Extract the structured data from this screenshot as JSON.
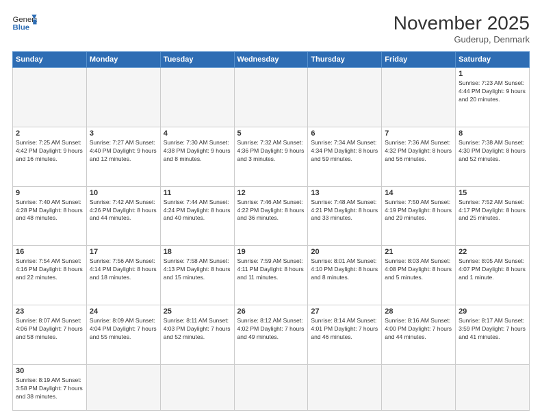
{
  "header": {
    "logo_general": "General",
    "logo_blue": "Blue",
    "month_year": "November 2025",
    "location": "Guderup, Denmark"
  },
  "weekdays": [
    "Sunday",
    "Monday",
    "Tuesday",
    "Wednesday",
    "Thursday",
    "Friday",
    "Saturday"
  ],
  "weeks": [
    [
      {
        "day": "",
        "info": "",
        "empty": true
      },
      {
        "day": "",
        "info": "",
        "empty": true
      },
      {
        "day": "",
        "info": "",
        "empty": true
      },
      {
        "day": "",
        "info": "",
        "empty": true
      },
      {
        "day": "",
        "info": "",
        "empty": true
      },
      {
        "day": "",
        "info": "",
        "empty": true
      },
      {
        "day": "1",
        "info": "Sunrise: 7:23 AM\nSunset: 4:44 PM\nDaylight: 9 hours\nand 20 minutes."
      }
    ],
    [
      {
        "day": "2",
        "info": "Sunrise: 7:25 AM\nSunset: 4:42 PM\nDaylight: 9 hours\nand 16 minutes."
      },
      {
        "day": "3",
        "info": "Sunrise: 7:27 AM\nSunset: 4:40 PM\nDaylight: 9 hours\nand 12 minutes."
      },
      {
        "day": "4",
        "info": "Sunrise: 7:30 AM\nSunset: 4:38 PM\nDaylight: 9 hours\nand 8 minutes."
      },
      {
        "day": "5",
        "info": "Sunrise: 7:32 AM\nSunset: 4:36 PM\nDaylight: 9 hours\nand 3 minutes."
      },
      {
        "day": "6",
        "info": "Sunrise: 7:34 AM\nSunset: 4:34 PM\nDaylight: 8 hours\nand 59 minutes."
      },
      {
        "day": "7",
        "info": "Sunrise: 7:36 AM\nSunset: 4:32 PM\nDaylight: 8 hours\nand 56 minutes."
      },
      {
        "day": "8",
        "info": "Sunrise: 7:38 AM\nSunset: 4:30 PM\nDaylight: 8 hours\nand 52 minutes."
      }
    ],
    [
      {
        "day": "9",
        "info": "Sunrise: 7:40 AM\nSunset: 4:28 PM\nDaylight: 8 hours\nand 48 minutes."
      },
      {
        "day": "10",
        "info": "Sunrise: 7:42 AM\nSunset: 4:26 PM\nDaylight: 8 hours\nand 44 minutes."
      },
      {
        "day": "11",
        "info": "Sunrise: 7:44 AM\nSunset: 4:24 PM\nDaylight: 8 hours\nand 40 minutes."
      },
      {
        "day": "12",
        "info": "Sunrise: 7:46 AM\nSunset: 4:22 PM\nDaylight: 8 hours\nand 36 minutes."
      },
      {
        "day": "13",
        "info": "Sunrise: 7:48 AM\nSunset: 4:21 PM\nDaylight: 8 hours\nand 33 minutes."
      },
      {
        "day": "14",
        "info": "Sunrise: 7:50 AM\nSunset: 4:19 PM\nDaylight: 8 hours\nand 29 minutes."
      },
      {
        "day": "15",
        "info": "Sunrise: 7:52 AM\nSunset: 4:17 PM\nDaylight: 8 hours\nand 25 minutes."
      }
    ],
    [
      {
        "day": "16",
        "info": "Sunrise: 7:54 AM\nSunset: 4:16 PM\nDaylight: 8 hours\nand 22 minutes."
      },
      {
        "day": "17",
        "info": "Sunrise: 7:56 AM\nSunset: 4:14 PM\nDaylight: 8 hours\nand 18 minutes."
      },
      {
        "day": "18",
        "info": "Sunrise: 7:58 AM\nSunset: 4:13 PM\nDaylight: 8 hours\nand 15 minutes."
      },
      {
        "day": "19",
        "info": "Sunrise: 7:59 AM\nSunset: 4:11 PM\nDaylight: 8 hours\nand 11 minutes."
      },
      {
        "day": "20",
        "info": "Sunrise: 8:01 AM\nSunset: 4:10 PM\nDaylight: 8 hours\nand 8 minutes."
      },
      {
        "day": "21",
        "info": "Sunrise: 8:03 AM\nSunset: 4:08 PM\nDaylight: 8 hours\nand 5 minutes."
      },
      {
        "day": "22",
        "info": "Sunrise: 8:05 AM\nSunset: 4:07 PM\nDaylight: 8 hours\nand 1 minute."
      }
    ],
    [
      {
        "day": "23",
        "info": "Sunrise: 8:07 AM\nSunset: 4:06 PM\nDaylight: 7 hours\nand 58 minutes."
      },
      {
        "day": "24",
        "info": "Sunrise: 8:09 AM\nSunset: 4:04 PM\nDaylight: 7 hours\nand 55 minutes."
      },
      {
        "day": "25",
        "info": "Sunrise: 8:11 AM\nSunset: 4:03 PM\nDaylight: 7 hours\nand 52 minutes."
      },
      {
        "day": "26",
        "info": "Sunrise: 8:12 AM\nSunset: 4:02 PM\nDaylight: 7 hours\nand 49 minutes."
      },
      {
        "day": "27",
        "info": "Sunrise: 8:14 AM\nSunset: 4:01 PM\nDaylight: 7 hours\nand 46 minutes."
      },
      {
        "day": "28",
        "info": "Sunrise: 8:16 AM\nSunset: 4:00 PM\nDaylight: 7 hours\nand 44 minutes."
      },
      {
        "day": "29",
        "info": "Sunrise: 8:17 AM\nSunset: 3:59 PM\nDaylight: 7 hours\nand 41 minutes."
      }
    ],
    [
      {
        "day": "30",
        "info": "Sunrise: 8:19 AM\nSunset: 3:58 PM\nDaylight: 7 hours\nand 38 minutes.",
        "lastrow": true
      },
      {
        "day": "",
        "info": "",
        "empty": true,
        "lastrow": true
      },
      {
        "day": "",
        "info": "",
        "empty": true,
        "lastrow": true
      },
      {
        "day": "",
        "info": "",
        "empty": true,
        "lastrow": true
      },
      {
        "day": "",
        "info": "",
        "empty": true,
        "lastrow": true
      },
      {
        "day": "",
        "info": "",
        "empty": true,
        "lastrow": true
      },
      {
        "day": "",
        "info": "",
        "empty": true,
        "lastrow": true
      }
    ]
  ]
}
